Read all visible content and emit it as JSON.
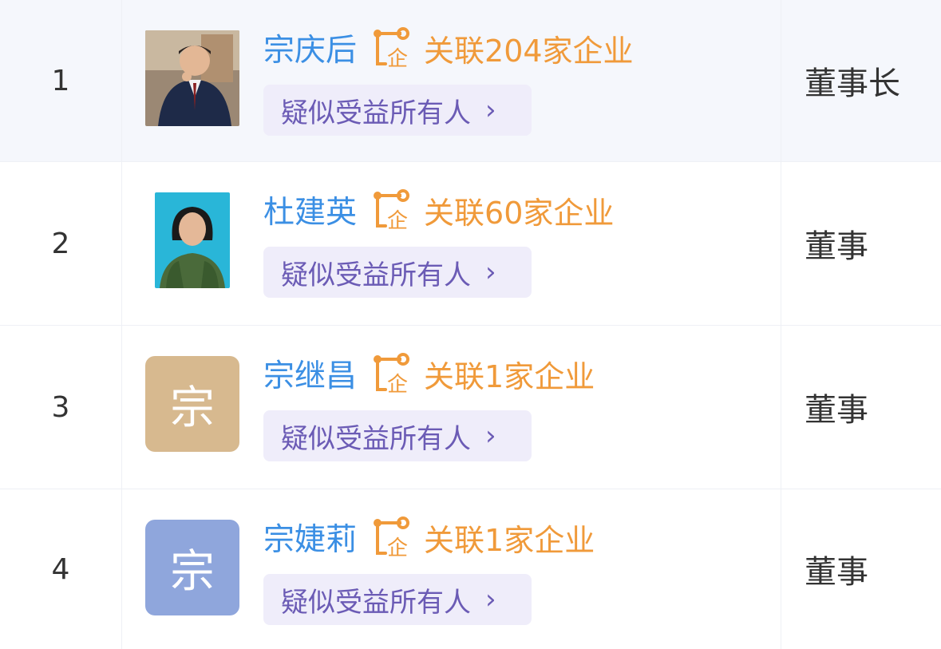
{
  "rows": [
    {
      "index": "1",
      "name": "宗庆后",
      "related": "关联204家企业",
      "badge": "疑似受益所有人",
      "role": "董事长",
      "avatar": {
        "type": "photo",
        "bg": "#8a7a6a"
      }
    },
    {
      "index": "2",
      "name": "杜建英",
      "related": "关联60家企业",
      "badge": "疑似受益所有人",
      "role": "董事",
      "avatar": {
        "type": "photo",
        "bg": "#29b6d8"
      }
    },
    {
      "index": "3",
      "name": "宗继昌",
      "related": "关联1家企业",
      "badge": "疑似受益所有人",
      "role": "董事",
      "avatar": {
        "type": "letter",
        "letter": "宗",
        "bg": "#d7b98f"
      }
    },
    {
      "index": "4",
      "name": "宗婕莉",
      "related": "关联1家企业",
      "badge": "疑似受益所有人",
      "role": "董事",
      "avatar": {
        "type": "letter",
        "letter": "宗",
        "bg": "#8fa6dc"
      }
    }
  ],
  "colors": {
    "name": "#3b8fe4",
    "related": "#f09a3a",
    "badge_bg": "#efedfa",
    "badge_text": "#6b5bb5"
  },
  "icons": {
    "related": "enterprise-link-icon",
    "badge_arrow": "chevron-right-icon"
  }
}
